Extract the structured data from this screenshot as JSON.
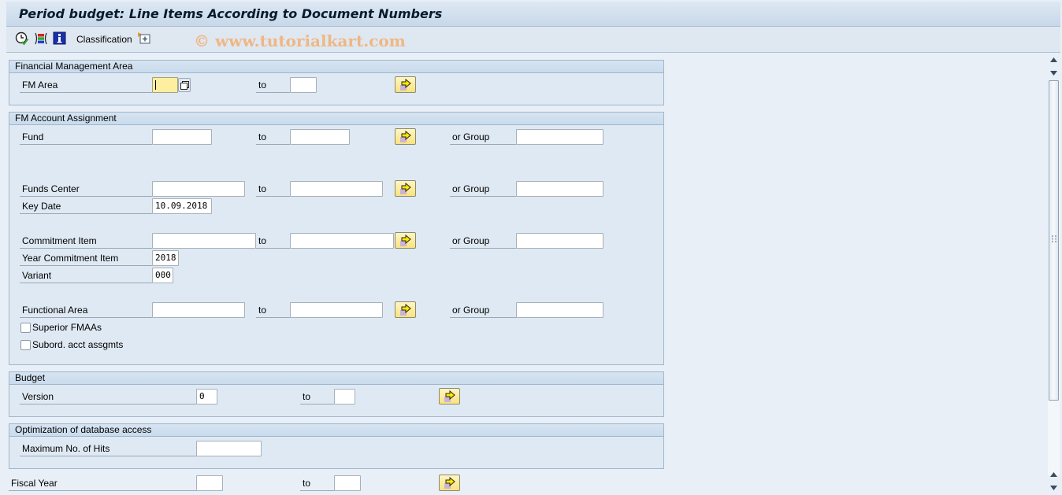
{
  "window": {
    "title": "Period budget: Line Items According to Document Numbers"
  },
  "toolbar": {
    "items": [
      {
        "icon": "execute-clock-icon",
        "label": ""
      },
      {
        "icon": "selection-options-icon",
        "label": ""
      },
      {
        "icon": "information-icon",
        "label": ""
      },
      {
        "icon": "",
        "label": "Classification"
      },
      {
        "icon": "add-classification-icon",
        "label": ""
      }
    ],
    "classification_label": "Classification",
    "watermark": "© www.tutorialkart.com"
  },
  "groups": {
    "fm_area": {
      "title": "Financial Management Area",
      "fm_area_label": "FM Area",
      "fm_area_from": "",
      "to_label": "to",
      "fm_area_to": ""
    },
    "account_assignment": {
      "title": "FM Account Assignment",
      "fund_label": "Fund",
      "fund_from": "",
      "fund_to": "",
      "fund_group_label": "or Group",
      "fund_group": "",
      "funds_center_label": "Funds Center",
      "funds_center_from": "",
      "funds_center_to": "",
      "funds_center_group_label": "or Group",
      "funds_center_group": "",
      "key_date_label": "Key Date",
      "key_date": "10.09.2018",
      "commitment_item_label": "Commitment Item",
      "commitment_item_from": "",
      "commitment_item_to": "",
      "commitment_item_group_label": "or Group",
      "commitment_item_group": "",
      "year_commitment_item_label": "Year Commitment Item",
      "year_commitment_item": "2018",
      "variant_label": "Variant",
      "variant": "000",
      "functional_area_label": "Functional Area",
      "functional_area_from": "",
      "functional_area_to": "",
      "functional_area_group_label": "or Group",
      "functional_area_group": "",
      "to_label": "to",
      "superior_fmaas_label": "Superior FMAAs",
      "superior_fmaas_checked": false,
      "subord_label": "Subord. acct assgmts",
      "subord_checked": false
    },
    "budget": {
      "title": "Budget",
      "version_label": "Version",
      "version_from": "0",
      "to_label": "to",
      "version_to": ""
    },
    "optimization": {
      "title": "Optimization of database access",
      "max_hits_label": "Maximum No. of Hits",
      "max_hits": ""
    }
  },
  "fiscal_year": {
    "label": "Fiscal Year",
    "from": "",
    "to_label": "to",
    "to": ""
  }
}
